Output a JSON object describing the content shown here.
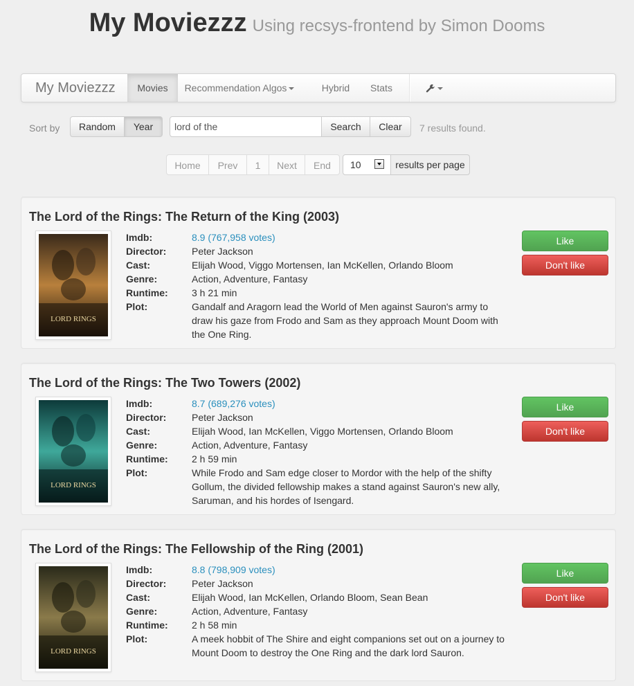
{
  "header": {
    "title": "My Moviezzz",
    "subtitle": "Using recsys-frontend by Simon Dooms"
  },
  "navbar": {
    "brand": "My Moviezzz",
    "items": [
      {
        "label": "Movies",
        "active": true
      },
      {
        "label": "Recommendation Algos",
        "dropdown": true
      },
      {
        "label": "Hybrid"
      },
      {
        "label": "Stats"
      }
    ],
    "settings_icon": "wrench-icon"
  },
  "controls": {
    "sort_label": "Sort by",
    "sort_options": [
      {
        "label": "Random",
        "active": false
      },
      {
        "label": "Year",
        "active": true
      }
    ],
    "search_value": "lord of the",
    "search_button": "Search",
    "clear_button": "Clear",
    "results_text": "7 results found."
  },
  "pagination": {
    "home": "Home",
    "prev": "Prev",
    "page": "1",
    "next": "Next",
    "end": "End",
    "per_page_value": "10",
    "per_page_label": "results per page"
  },
  "labels": {
    "imdb": "Imdb:",
    "director": "Director:",
    "cast": "Cast:",
    "genre": "Genre:",
    "runtime": "Runtime:",
    "plot": "Plot:",
    "like": "Like",
    "dislike": "Don't like"
  },
  "movies": [
    {
      "title": "The Lord of the Rings: The Return of the King (2003)",
      "imdb": "8.9 (767,958 votes)",
      "director": "Peter Jackson",
      "cast": "Elijah Wood, Viggo Mortensen, Ian McKellen, Orlando Bloom",
      "genre": "Action, Adventure, Fantasy",
      "runtime": "3 h 21 min",
      "plot": "Gandalf and Aragorn lead the World of Men against Sauron's army to draw his gaze from Frodo and Sam as they approach Mount Doom with the One Ring.",
      "poster_colors": [
        "#3a2a1a",
        "#b8803c",
        "#1a120a"
      ],
      "poster_text": "LORD RINGS"
    },
    {
      "title": "The Lord of the Rings: The Two Towers (2002)",
      "imdb": "8.7 (689,276 votes)",
      "director": "Peter Jackson",
      "cast": "Elijah Wood, Ian McKellen, Viggo Mortensen, Orlando Bloom",
      "genre": "Action, Adventure, Fantasy",
      "runtime": "2 h 59 min",
      "plot": "While Frodo and Sam edge closer to Mordor with the help of the shifty Gollum, the divided fellowship makes a stand against Sauron's new ally, Saruman, and his hordes of Isengard.",
      "poster_colors": [
        "#0d3a3a",
        "#3fa89a",
        "#061a1a"
      ],
      "poster_text": "LORD RINGS"
    },
    {
      "title": "The Lord of the Rings: The Fellowship of the Ring (2001)",
      "imdb": "8.8 (798,909 votes)",
      "director": "Peter Jackson",
      "cast": "Elijah Wood, Ian McKellen, Orlando Bloom, Sean Bean",
      "genre": "Action, Adventure, Fantasy",
      "runtime": "2 h 58 min",
      "plot": "A meek hobbit of The Shire and eight companions set out on a journey to Mount Doom to destroy the One Ring and the dark lord Sauron.",
      "poster_colors": [
        "#2a2a1a",
        "#8a7a4a",
        "#121208"
      ],
      "poster_text": "LORD RINGS"
    }
  ]
}
